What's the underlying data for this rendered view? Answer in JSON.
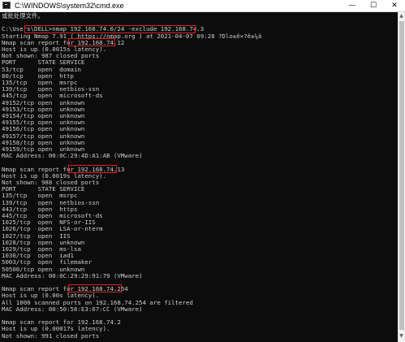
{
  "window": {
    "title": "C:\\WINDOWS\\system32\\cmd.exe",
    "controls": {
      "minimize": "—",
      "maximize": "☐",
      "close": "✕"
    }
  },
  "scrollbar": {
    "up_arrow": "▲",
    "down_arrow": "▼"
  },
  "console": {
    "lines": [
      "或批处理文件。",
      "",
      "C:\\Users\\DELL>nmap 192.168.74.0/24 -exclude 192.168.74.3",
      "Starting Nmap 7.91 ( https://nmap.org ) at 2021-04-07 09:28 ?Dlo±ê×?ê±¼ä",
      "Nmap scan report for 192.168.74.12",
      "Host is up (0.0015s latency).",
      "Not shown: 987 closed ports",
      "PORT      STATE SERVICE",
      "53/tcp    open  domain",
      "80/tcp    open  http",
      "135/tcp   open  msrpc",
      "139/tcp   open  netbios-ssn",
      "445/tcp   open  microsoft-ds",
      "49152/tcp open  unknown",
      "49153/tcp open  unknown",
      "49154/tcp open  unknown",
      "49155/tcp open  unknown",
      "49156/tcp open  unknown",
      "49157/tcp open  unknown",
      "49158/tcp open  unknown",
      "49159/tcp open  unknown",
      "MAC Address: 00:0C:29:4D:A1:AB (VMware)",
      "",
      "Nmap scan report for 192.168.74.13",
      "Host is up (0.0019s latency).",
      "Not shown: 988 closed ports",
      "PORT      STATE SERVICE",
      "135/tcp   open  msrpc",
      "139/tcp   open  netbios-ssn",
      "443/tcp   open  https",
      "445/tcp   open  microsoft-ds",
      "1025/tcp  open  NFS-or-IIS",
      "1026/tcp  open  LSA-or-nterm",
      "1027/tcp  open  IIS",
      "1028/tcp  open  unknown",
      "1029/tcp  open  ms-lsa",
      "1030/tcp  open  iad1",
      "5003/tcp  open  filemaker",
      "50500/tcp open  unknown",
      "MAC Address: 00:0C:29:29:91:79 (VMware)",
      "",
      "Nmap scan report for 192.168.74.254",
      "Host is up (0.00s latency).",
      "All 1000 scanned ports on 192.168.74.254 are filtered",
      "MAC Address: 00:50:56:E3:67:CC (VMware)",
      "",
      "Nmap scan report for 192.168.74.2",
      "Host is up (0.00017s latency).",
      "Not shown: 991 closed ports"
    ],
    "highlighted": [
      "nmap 192.168.74.0/24 -exclude 192.168.74.3",
      "192.168.74.12",
      "192.168.74.13",
      "192.168.74.254"
    ]
  },
  "colors": {
    "console_bg": "#0c0c0c",
    "console_fg": "#cccccc",
    "highlight": "#e02020",
    "titlebar_bg": "#ffffff"
  }
}
